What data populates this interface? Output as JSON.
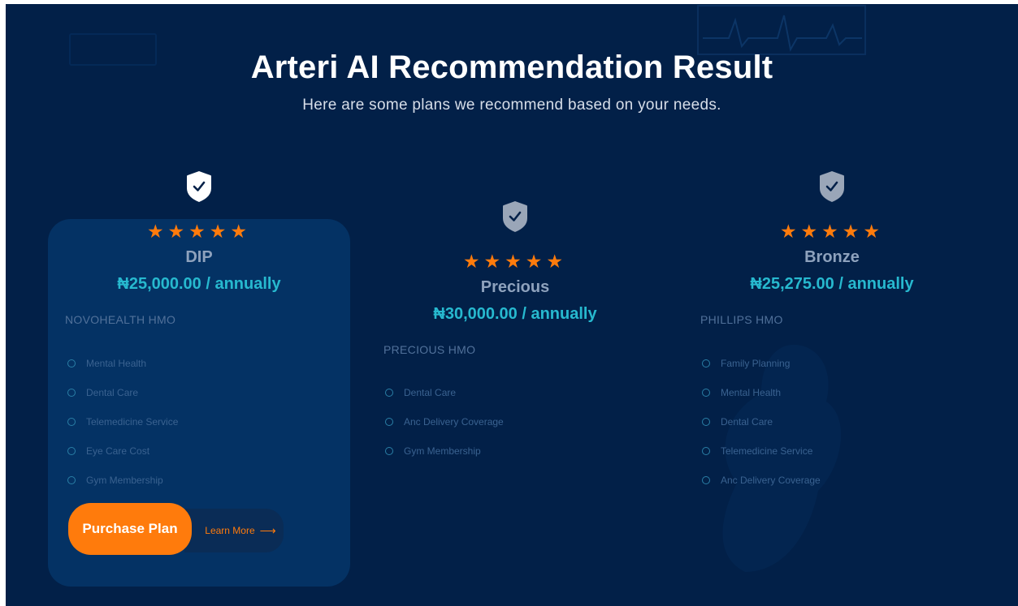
{
  "header": {
    "title": "Arteri AI Recommendation Result",
    "subtitle": "Here are some plans we recommend based on your needs."
  },
  "plans": [
    {
      "stars": "★★★★★",
      "rating": 5,
      "name": "DIP",
      "price": "₦25,000.00 / annually",
      "hmo": "NOVOHEALTH HMO",
      "features": [
        "Mental Health",
        "Dental Care",
        "Telemedicine Service",
        "Eye Care Cost",
        "Gym Membership"
      ],
      "shield_color": "#ffffff"
    },
    {
      "stars": "★★★★★",
      "rating": 5,
      "name": "Precious",
      "price": "₦30,000.00 / annually",
      "hmo": "PRECIOUS HMO",
      "features": [
        "Dental Care",
        "Anc Delivery Coverage",
        "Gym Membership"
      ],
      "shield_color": "#9aa6b8"
    },
    {
      "stars": "★★★★★",
      "rating": 5,
      "name": "Bronze",
      "price": "₦25,275.00 / annually",
      "hmo": "PHILLIPS HMO",
      "features": [
        "Family Planning",
        "Mental Health",
        "Dental Care",
        "Telemedicine Service",
        "Anc Delivery Coverage"
      ],
      "shield_color": "#9aa6b8"
    }
  ],
  "actions": {
    "purchase_label": "Purchase Plan",
    "learn_more_label": "Learn More",
    "arrow_icon": "arrow-right-icon"
  },
  "colors": {
    "background": "#022048",
    "accent": "#ff7b0c",
    "price": "#27b9cf"
  }
}
